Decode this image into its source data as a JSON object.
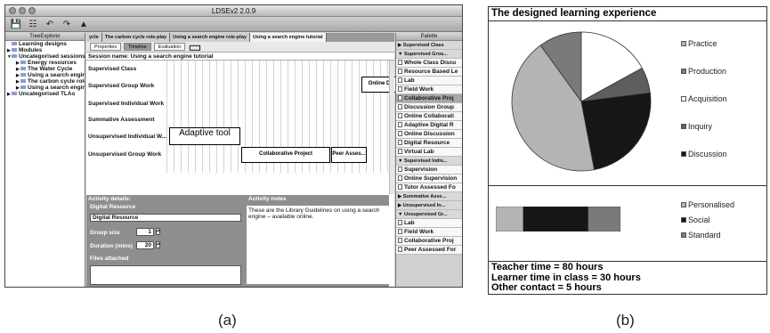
{
  "app": {
    "title": "LDSEv2 2.0.9",
    "toolbar_icons": [
      "save-icon",
      "saveas-icon",
      "undo-icon",
      "redo-icon",
      "warning-icon"
    ]
  },
  "tree": {
    "title": "TreeExplorer",
    "items": [
      {
        "label": "Learning designs",
        "indent": 0,
        "toggle": ""
      },
      {
        "label": "Modules",
        "indent": 0,
        "toggle": "▶"
      },
      {
        "label": "Uncategorised sessions",
        "indent": 0,
        "toggle": "▼"
      },
      {
        "label": "Energy resources",
        "indent": 1,
        "toggle": "▶"
      },
      {
        "label": "The Water Cycle",
        "indent": 1,
        "toggle": "▶"
      },
      {
        "label": "Using a search engine",
        "indent": 1,
        "toggle": "▶"
      },
      {
        "label": "The carbon cycle role",
        "indent": 1,
        "toggle": "▶"
      },
      {
        "label": "Using a search engine",
        "indent": 1,
        "toggle": "▶"
      },
      {
        "label": "Uncategorised TLAs",
        "indent": 0,
        "toggle": "▶"
      }
    ]
  },
  "tabs": [
    {
      "label": "ycle",
      "active": false
    },
    {
      "label": "The carbon cycle role-play",
      "active": false
    },
    {
      "label": "Using a search engine role-play",
      "active": false
    },
    {
      "label": "Using a search engine tutorial",
      "active": true
    }
  ],
  "subtabs": [
    {
      "label": "Properties",
      "active": false
    },
    {
      "label": "Timeline",
      "active": true
    },
    {
      "label": "Evaluation",
      "active": false
    }
  ],
  "session_name": "Session name: Using a search engine tutorial",
  "timeline": {
    "rows": [
      "Supervised Class",
      "Supervised Group Work",
      "Supervised Individual Work",
      "Summative Assessment",
      "Unsupervised Individual W...",
      "Unsupervised Group Work"
    ],
    "activities": {
      "online": "Online D",
      "adaptive": "Adaptive tool",
      "collab": "Collaborative Project",
      "peer": "Peer Asses..."
    }
  },
  "details": {
    "header": "Activity details:",
    "resource_label": "Digital Resource",
    "resource_value": "Digital Resource",
    "group_size_label": "Group size",
    "group_size_value": "1",
    "duration_label": "Duration (mins)",
    "duration_value": "20",
    "files_label": "Files attached",
    "notes_header": "Activity notes",
    "notes_text": "These are the Library Guidelines on using a search engine – available online."
  },
  "palette": {
    "title": "Palette",
    "items": [
      {
        "label": "Supervised Class",
        "type": "group",
        "toggle": "▶"
      },
      {
        "label": "Supervised Grou...",
        "type": "group",
        "toggle": "▼"
      },
      {
        "label": "Whole Class Discu",
        "type": "item"
      },
      {
        "label": "Resource Based Le",
        "type": "item"
      },
      {
        "label": "Lab",
        "type": "item"
      },
      {
        "label": "Field Work",
        "type": "item"
      },
      {
        "label": "Collaborative Proj",
        "type": "item",
        "highlight": true
      },
      {
        "label": "Discussion Group",
        "type": "item"
      },
      {
        "label": "Online Collaborati",
        "type": "item"
      },
      {
        "label": "Adaptive Digital R",
        "type": "item"
      },
      {
        "label": "Online Discussion",
        "type": "item"
      },
      {
        "label": "Digital Resource",
        "type": "item"
      },
      {
        "label": "Virtual Lab",
        "type": "item"
      },
      {
        "label": "Supervised Indiv...",
        "type": "group",
        "toggle": "▼"
      },
      {
        "label": "Supervision",
        "type": "item"
      },
      {
        "label": "Online Supervision",
        "type": "item"
      },
      {
        "label": "Tutor Assessed Fo",
        "type": "item"
      },
      {
        "label": "Summative Asse...",
        "type": "group",
        "toggle": "▶"
      },
      {
        "label": "Unsupervised In...",
        "type": "group",
        "toggle": "▶"
      },
      {
        "label": "Unsupervised Gr...",
        "type": "group",
        "toggle": "▼"
      },
      {
        "label": "Lab",
        "type": "item"
      },
      {
        "label": "Field Work",
        "type": "item"
      },
      {
        "label": "Collaborative Proj",
        "type": "item"
      },
      {
        "label": "Peer Assessed For",
        "type": "item"
      }
    ]
  },
  "captions": {
    "a": "(a)",
    "b": "(b)"
  },
  "figure": {
    "title": "The designed learning experience",
    "stats": [
      "Teacher time = 80 hours",
      "Learner time in class = 30 hours",
      "Other contact = 5 hours"
    ]
  },
  "chart_data": [
    {
      "type": "pie",
      "title": "The designed learning experience",
      "legend_position": "right",
      "series": [
        {
          "name": "Practice",
          "value": 43,
          "color": "#b4b4b4"
        },
        {
          "name": "Production",
          "value": 10,
          "color": "#7a7a7a"
        },
        {
          "name": "Acquisition",
          "value": 17,
          "color": "#ffffff"
        },
        {
          "name": "Inquiry",
          "value": 6,
          "color": "#5e5e5e"
        },
        {
          "name": "Discussion",
          "value": 24,
          "color": "#161616"
        }
      ]
    },
    {
      "type": "bar",
      "stacked": true,
      "orientation": "horizontal",
      "legend_position": "right",
      "series": [
        {
          "name": "Personalised",
          "value": 22,
          "color": "#b4b4b4"
        },
        {
          "name": "Social",
          "value": 52,
          "color": "#161616"
        },
        {
          "name": "Standard",
          "value": 26,
          "color": "#7a7a7a"
        }
      ]
    }
  ]
}
